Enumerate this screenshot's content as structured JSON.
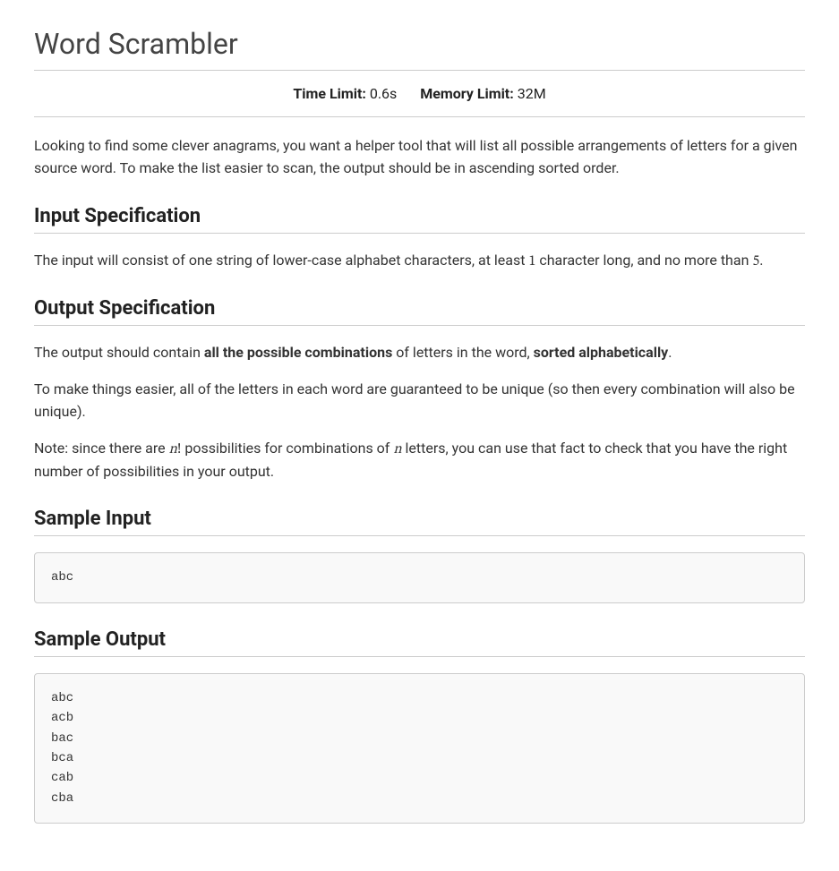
{
  "title": "Word Scrambler",
  "limits": {
    "time_label": "Time Limit:",
    "time_value": "0.6s",
    "memory_label": "Memory Limit:",
    "memory_value": "32M"
  },
  "intro": "Looking to find some clever anagrams, you want a helper tool that will list all possible arrangements of letters for a given source word. To make the list easier to scan, the output should be in ascending sorted order.",
  "sections": {
    "input_spec": {
      "heading": "Input Specification",
      "p1_a": "The input will consist of one string of lower-case alphabet characters, at least ",
      "p1_num1": "1",
      "p1_b": " character long, and no more than ",
      "p1_num2": "5",
      "p1_c": "."
    },
    "output_spec": {
      "heading": "Output Specification",
      "p1_a": "The output should contain ",
      "p1_bold1": "all the possible combinations",
      "p1_b": " of letters in the word, ",
      "p1_bold2": "sorted alphabetically",
      "p1_c": ".",
      "p2": "To make things easier, all of the letters in each word are guaranteed to be unique (so then every combination will also be unique).",
      "p3_a": "Note: since there are ",
      "p3_var1": "n",
      "p3_fact": "!",
      "p3_b": " possibilities for combinations of ",
      "p3_var2": "n",
      "p3_c": " letters, you can use that fact to check that you have the right number of possibilities in your output."
    },
    "sample_input": {
      "heading": "Sample Input",
      "content": "abc"
    },
    "sample_output": {
      "heading": "Sample Output",
      "content": "abc\nacb\nbac\nbca\ncab\ncba"
    }
  }
}
